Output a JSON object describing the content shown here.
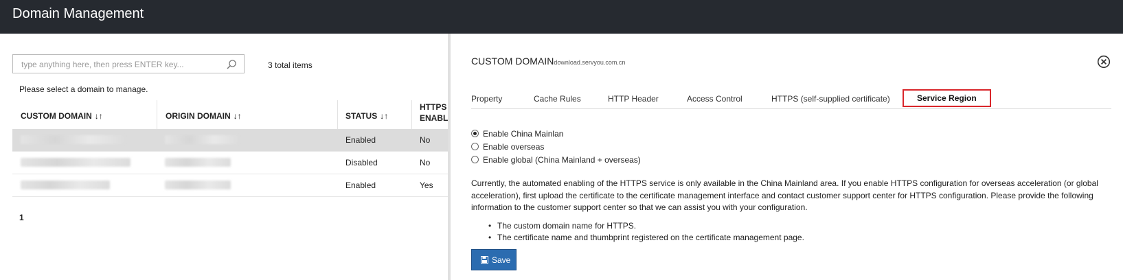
{
  "header": {
    "title": "Domain Management"
  },
  "left": {
    "search_placeholder": "type anything here, then press ENTER key...",
    "total": "3 total items",
    "hint": "Please select a domain to manage.",
    "columns": [
      {
        "label": "CUSTOM DOMAIN",
        "sortable": true
      },
      {
        "label": "ORIGIN DOMAIN",
        "sortable": true
      },
      {
        "label": "STATUS",
        "sortable": true
      },
      {
        "label": "HTTPS ENABL",
        "sortable": false
      }
    ],
    "rows": [
      {
        "status": "Enabled",
        "https": "No",
        "selected": true
      },
      {
        "status": "Disabled",
        "https": "No",
        "selected": false
      },
      {
        "status": "Enabled",
        "https": "Yes",
        "selected": false
      }
    ],
    "page": "1",
    "sort_glyph": "↓↑"
  },
  "right": {
    "title": "CUSTOM DOMAIN",
    "title_sub": "download.servyou.com.cn",
    "tabs": [
      {
        "label": "Property"
      },
      {
        "label": "Cache Rules"
      },
      {
        "label": "HTTP Header"
      },
      {
        "label": "Access Control"
      },
      {
        "label": "HTTPS (self-supplied certificate)"
      },
      {
        "label": "Service Region",
        "active": true
      }
    ],
    "options": [
      {
        "label": "Enable China Mainlan",
        "checked": true
      },
      {
        "label": "Enable overseas",
        "checked": false
      },
      {
        "label": "Enable global (China Mainland + overseas)",
        "checked": false
      }
    ],
    "description": "Currently, the automated enabling of the HTTPS service is only available in the China Mainland area. If you enable HTTPS configuration for overseas acceleration (or global acceleration), first upload the certificate to the certificate management interface and contact customer support center for HTTPS configuration. Please provide the following information to the customer support center so that we can assist you with your configuration.",
    "bullets": [
      "The custom domain name for HTTPS.",
      "The certificate name and thumbprint registered on the certificate management page."
    ],
    "save_label": "Save"
  },
  "colors": {
    "topbar": "#262a30",
    "accent": "#2b6cb0",
    "active_tab_border": "#d9262b"
  },
  "icons": {
    "search": "search-icon",
    "close": "close-circle-icon",
    "save": "floppy-disk-icon",
    "sort": "sort-icon"
  }
}
